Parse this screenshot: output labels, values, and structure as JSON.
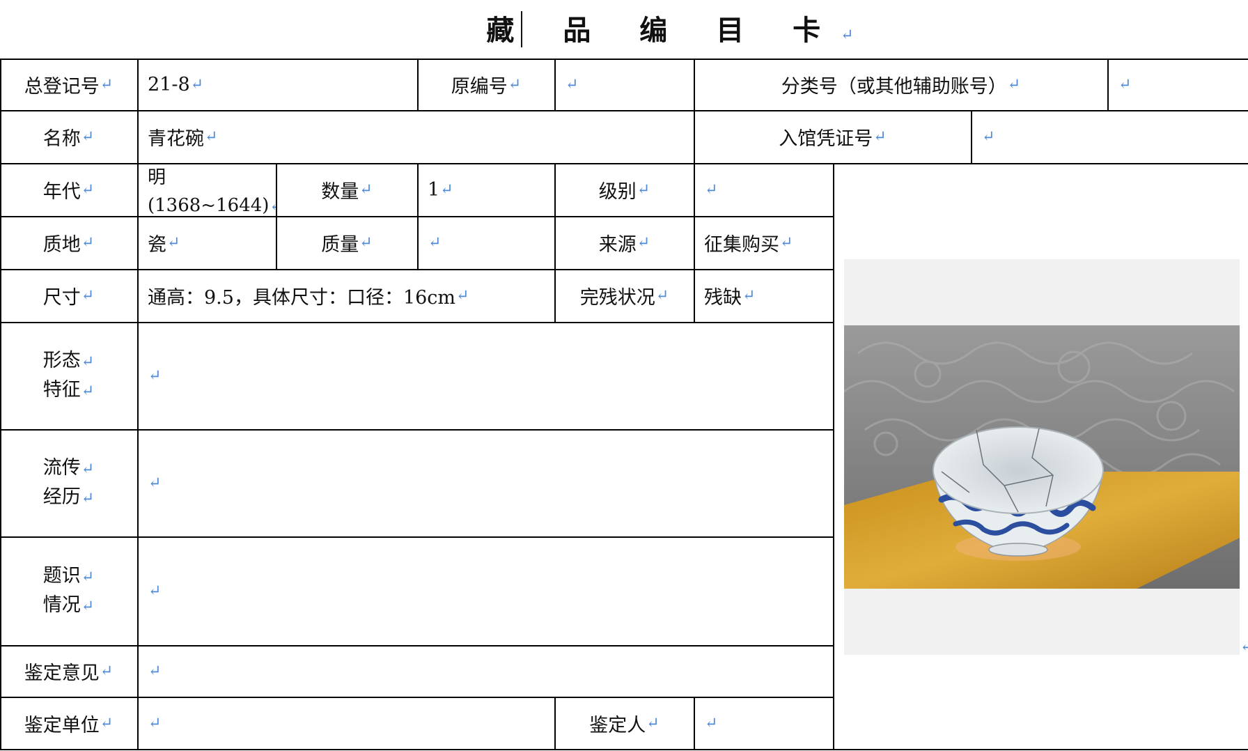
{
  "title": "藏 品 编 目 卡",
  "paragraph_mark": "↵",
  "fields": {
    "total_reg_label": "总登记号",
    "total_reg_value": "21-8",
    "orig_no_label": "原编号",
    "orig_no_value": "",
    "class_no_label": "分类号（或其他辅助账号）",
    "class_no_value": "",
    "name_label": "名称",
    "name_value": "青花碗",
    "entry_voucher_label": "入馆凭证号",
    "entry_voucher_value": "",
    "era_label": "年代",
    "era_value_line1": "明",
    "era_value_line2": "(1368~1644)",
    "quantity_label": "数量",
    "quantity_value": "1",
    "grade_label": "级别",
    "grade_value": "",
    "material_label": "质地",
    "material_value": "瓷",
    "weight_label": "质量",
    "weight_value": "",
    "source_label": "来源",
    "source_value": "征集购买",
    "size_label": "尺寸",
    "size_value": "通高：9.5，具体尺寸：口径：16cm",
    "condition_label": "完残状况",
    "condition_value": "残缺",
    "form_label_1": "形态",
    "form_label_2": "特征",
    "form_value": "",
    "history_label_1": "流传",
    "history_label_2": "经历",
    "history_value": "",
    "inscription_label_1": "题识",
    "inscription_label_2": "情况",
    "inscription_value": "",
    "opinion_label": "鉴定意见",
    "opinion_value": "",
    "unit_label": "鉴定单位",
    "unit_value": "",
    "appraiser_label": "鉴定人",
    "appraiser_value": ""
  },
  "photo": {
    "subject": "blue-and-white porcelain bowl",
    "colors": {
      "carpet": "#8a8a8a",
      "table": "#d9a52c",
      "bowl_blue": "#2b4f9e",
      "bowl_white": "#e8edf0"
    }
  }
}
